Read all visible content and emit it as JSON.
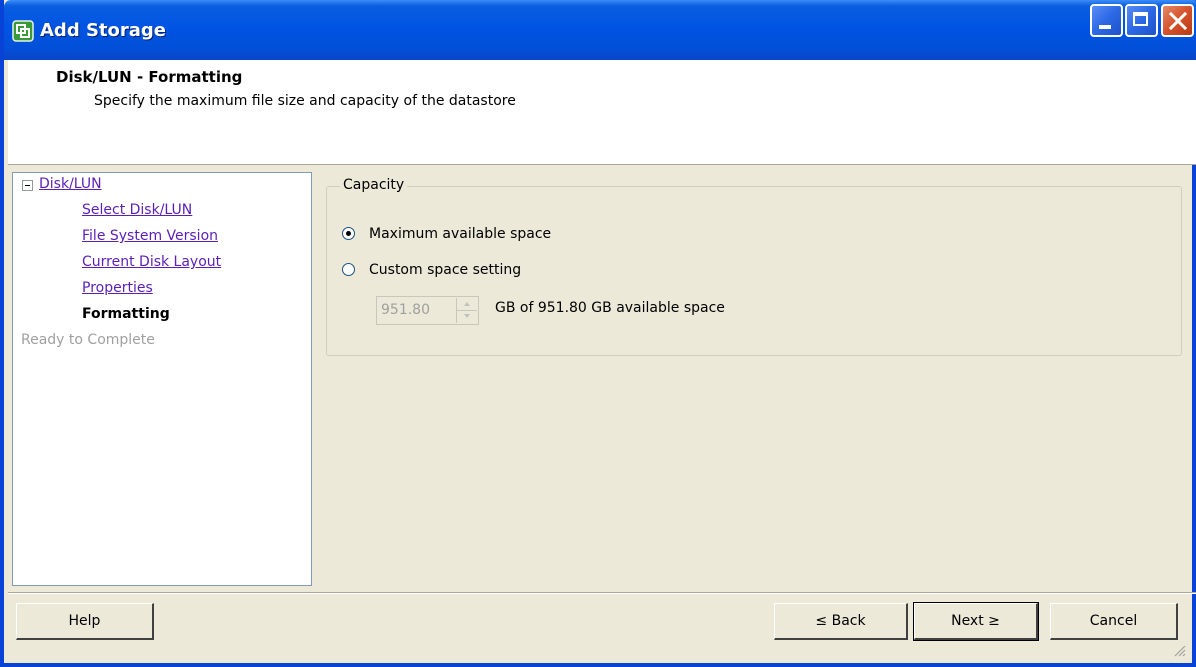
{
  "window": {
    "title": "Add Storage"
  },
  "header": {
    "title": "Disk/LUN - Formatting",
    "subtitle": "Specify the maximum file size and capacity of the datastore"
  },
  "nav": {
    "root": "Disk/LUN",
    "items": [
      {
        "label": "Select Disk/LUN",
        "state": "link"
      },
      {
        "label": "File System Version",
        "state": "link"
      },
      {
        "label": "Current Disk Layout",
        "state": "link"
      },
      {
        "label": "Properties",
        "state": "link"
      },
      {
        "label": "Formatting",
        "state": "current"
      },
      {
        "label": "Ready to Complete",
        "state": "disabled"
      }
    ]
  },
  "capacity": {
    "group_label": "Capacity",
    "option_max": "Maximum available space",
    "option_custom": "Custom space setting",
    "selected": "max",
    "spinner_value": "951.80",
    "available_text": "GB of 951.80 GB available space"
  },
  "buttons": {
    "help": "Help",
    "back": "≤ Back",
    "next": "Next ≥",
    "cancel": "Cancel"
  },
  "colors": {
    "titlebar": "#0054e3",
    "link": "#5a1fb8",
    "dialog_bg": "#ece9d8"
  }
}
